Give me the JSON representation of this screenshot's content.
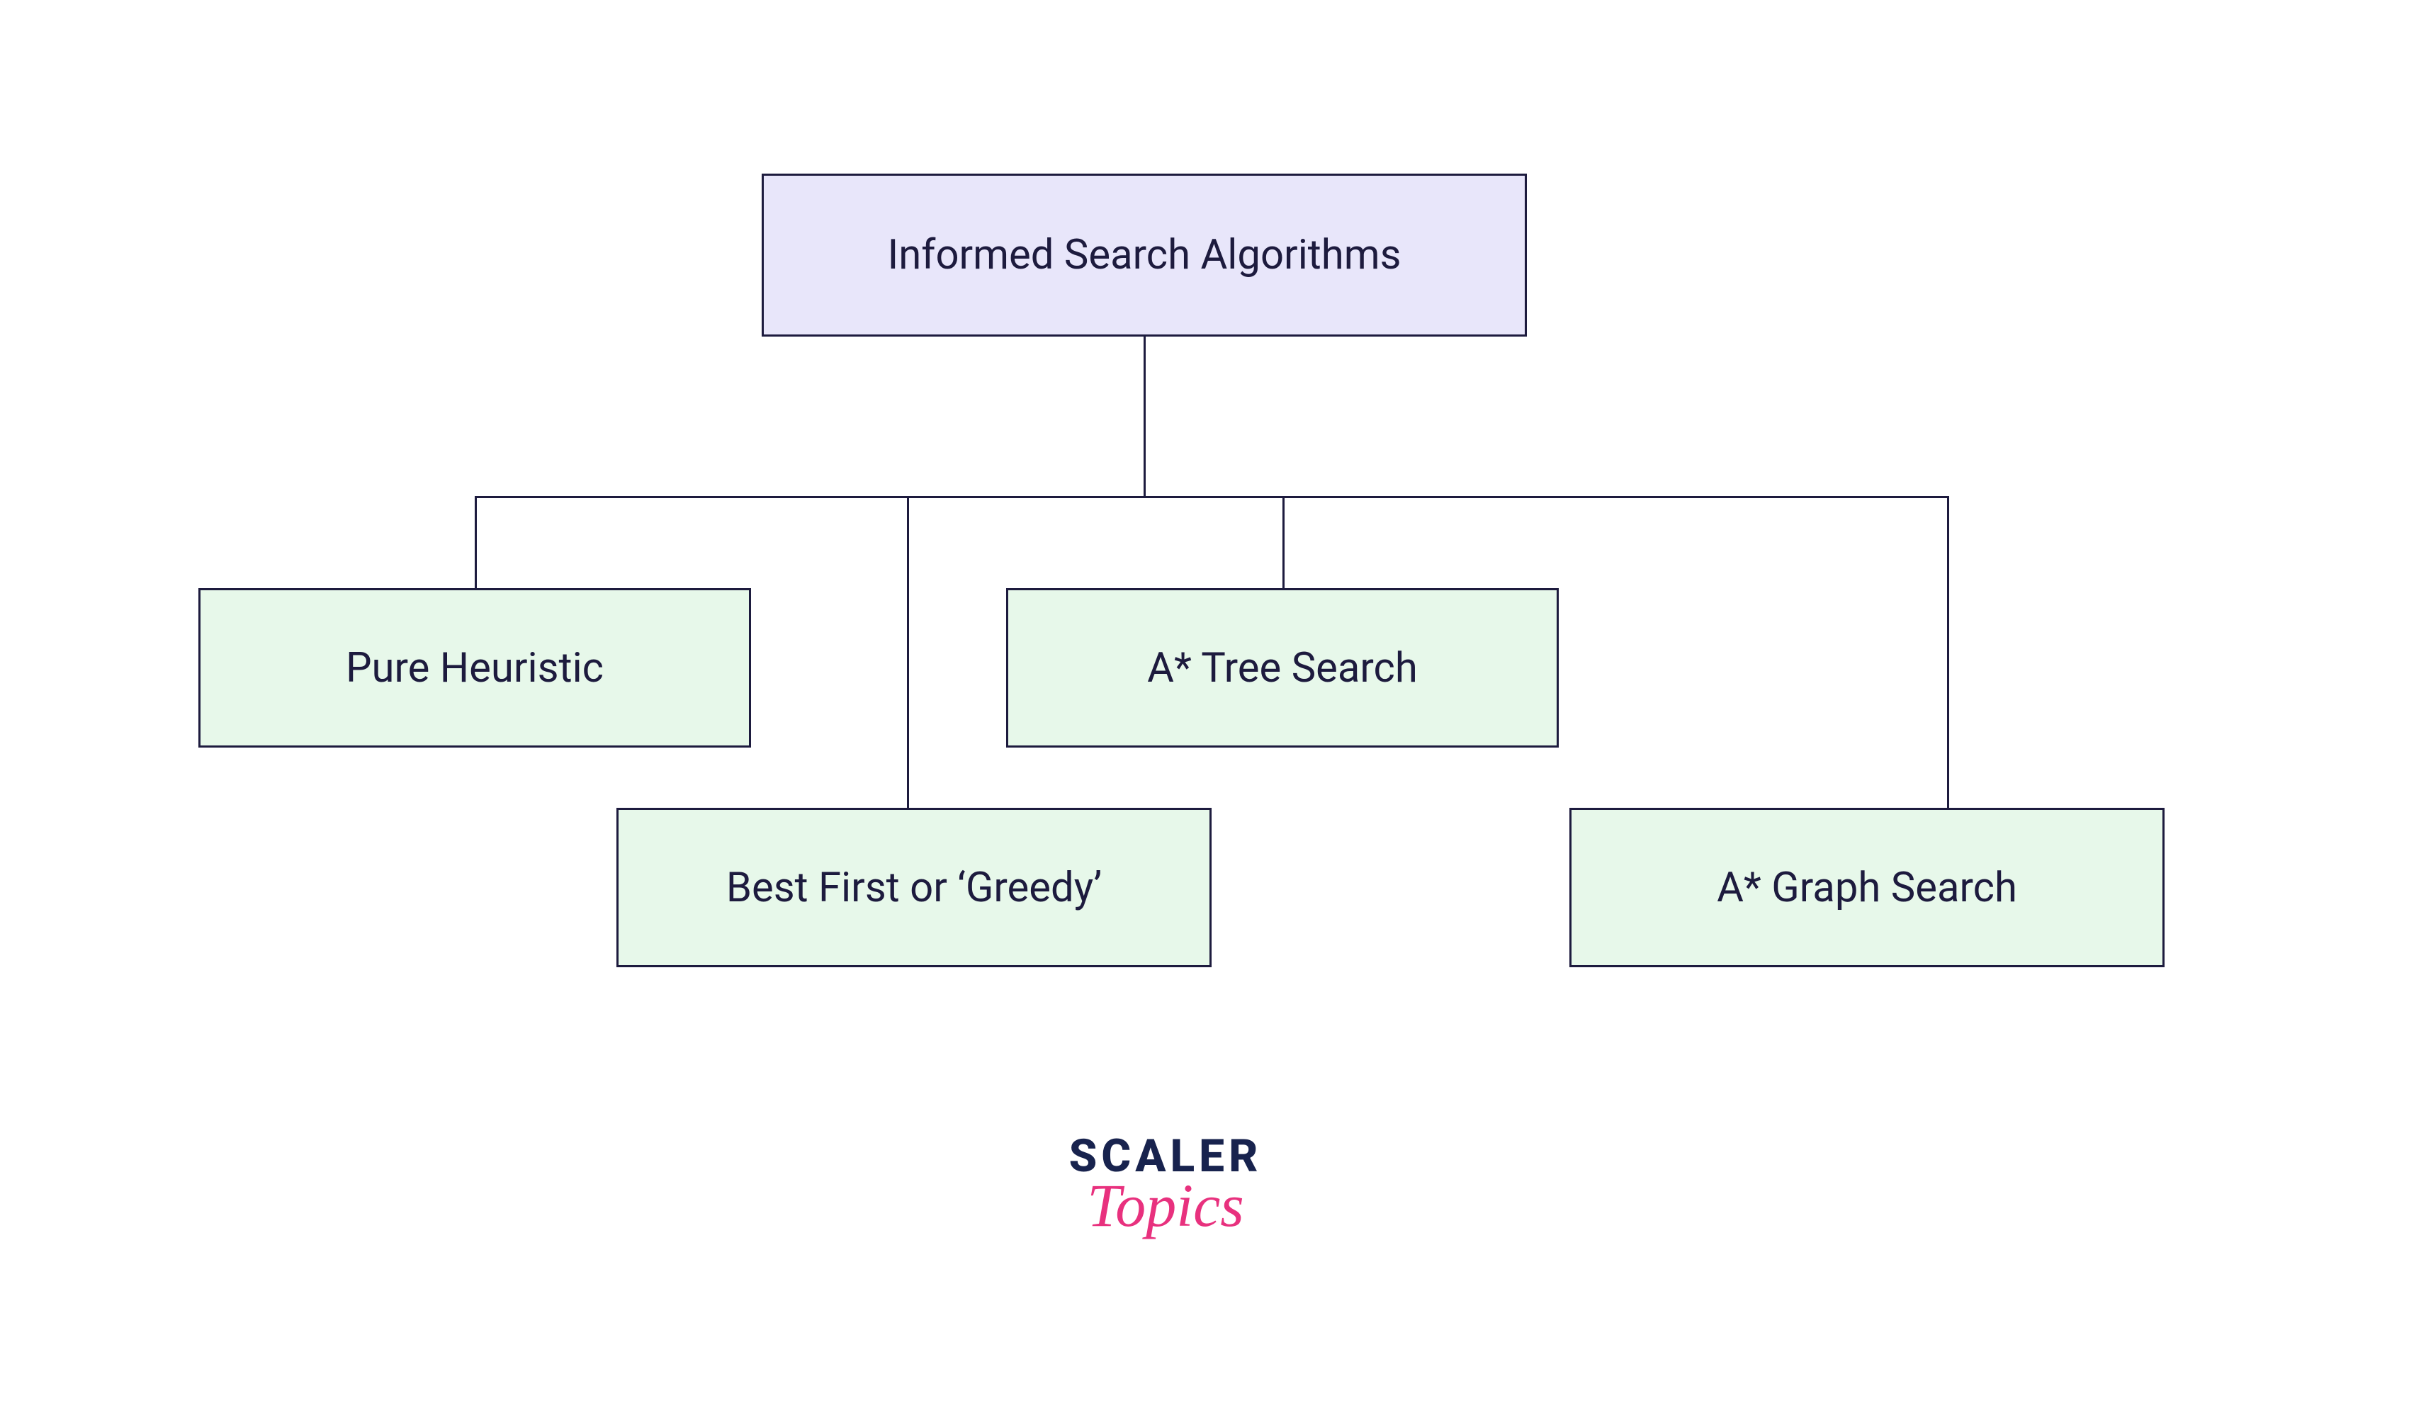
{
  "diagram": {
    "root": {
      "label": "Informed Search Algorithms"
    },
    "children": [
      {
        "label": "Pure Heuristic"
      },
      {
        "label": "Best First or ‘Greedy’"
      },
      {
        "label": "A* Tree Search"
      },
      {
        "label": "A* Graph Search"
      }
    ]
  },
  "branding": {
    "line1": "SCALER",
    "line2": "Topics"
  },
  "colors": {
    "root_fill": "#e8e6fa",
    "child_fill": "#e7f8ea",
    "outline": "#1d1b3e",
    "brand_dark": "#18234e",
    "brand_pink": "#e8317e"
  }
}
